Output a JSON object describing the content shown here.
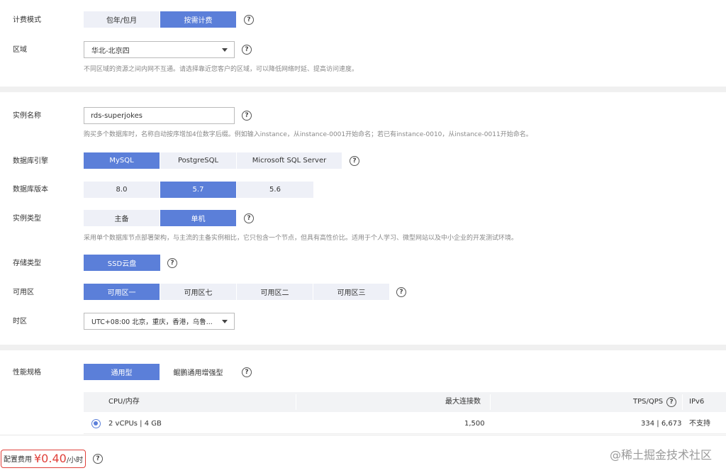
{
  "billing": {
    "label": "计费模式",
    "options": [
      "包年/包月",
      "按需计费"
    ],
    "selected": 1
  },
  "region": {
    "label": "区域",
    "value": "华北-北京四",
    "hint": "不同区域的资源之间内网不互通。请选择靠近您客户的区域，可以降低网络时延、提高访问速度。"
  },
  "instance_name": {
    "label": "实例名称",
    "value": "rds-superjokes",
    "hint": "购买多个数据库时，名称自动按序增加4位数字后缀。例如输入instance，从instance-0001开始命名；若已有instance-0010，从instance-0011开始命名。"
  },
  "engine": {
    "label": "数据库引擎",
    "options": [
      "MySQL",
      "PostgreSQL",
      "Microsoft SQL Server"
    ],
    "selected": 0
  },
  "version": {
    "label": "数据库版本",
    "options": [
      "8.0",
      "5.7",
      "5.6"
    ],
    "selected": 1
  },
  "instance_type": {
    "label": "实例类型",
    "options": [
      "主备",
      "单机"
    ],
    "selected": 1,
    "hint": "采用单个数据库节点部署架构，与主流的主备实例相比，它只包含一个节点，但具有高性价比。适用于个人学习、微型网站以及中小企业的开发测试环境。"
  },
  "storage": {
    "label": "存储类型",
    "options": [
      "SSD云盘"
    ],
    "selected": 0
  },
  "az": {
    "label": "可用区",
    "options": [
      "可用区一",
      "可用区七",
      "可用区二",
      "可用区三"
    ],
    "selected": 0
  },
  "timezone": {
    "label": "时区",
    "value": "UTC+08:00 北京，重庆，香港，乌鲁..."
  },
  "spec": {
    "label": "性能规格",
    "options": [
      "通用型",
      "鲲鹏通用增强型"
    ],
    "selected": 0,
    "table": {
      "headers": [
        "CPU/内存",
        "最大连接数",
        "TPS/QPS",
        "IPv6"
      ],
      "rows": [
        {
          "cpu_mem": "2 vCPUs | 4 GB",
          "max_conn": "1,500",
          "tps_qps": "334 | 6,673",
          "ipv6": "不支持"
        }
      ]
    }
  },
  "footer": {
    "price_label": "配置费用",
    "price_value": "¥0.40",
    "price_unit": "/小时",
    "watermark": "@稀土掘金技术社区"
  },
  "help_glyph": "?",
  "colors": {
    "accent": "#5b7fd9",
    "option_bg": "#eef0f7",
    "price_red": "#e0403a"
  }
}
